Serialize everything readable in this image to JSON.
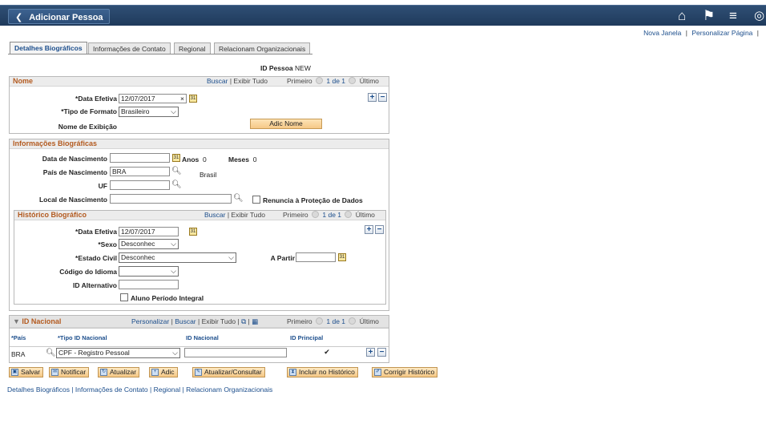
{
  "header": {
    "back_label": "Adicionar Pessoa",
    "icons": [
      "home-icon",
      "flag-icon",
      "menu-icon",
      "navbar-icon"
    ]
  },
  "top_links": {
    "new_window": "Nova Janela",
    "personalize": "Personalizar Página",
    "sep": "|"
  },
  "tabs": [
    {
      "label": "Detalhes Biográficos",
      "active": true
    },
    {
      "label": "Informações de Contato",
      "active": false
    },
    {
      "label": "Regional",
      "active": false
    },
    {
      "label": "Relacionam Organizacionais",
      "active": false
    }
  ],
  "person": {
    "id_label": "ID Pessoa",
    "id_value": "NEW"
  },
  "nome": {
    "title": "Nome",
    "find": "Buscar",
    "view_all": "Exibir Tudo",
    "first": "Primeiro",
    "page": "1 de 1",
    "last": "Último",
    "eff_date_label": "*Data Efetiva",
    "eff_date": "12/07/2017",
    "clear": "×",
    "format_label": "*Tipo de Formato",
    "format_value": "Brasileiro",
    "display_label": "Nome de Exibição",
    "add_name": "Adic Nome"
  },
  "bio": {
    "title": "Informações Biográficas",
    "birth_date_label": "Data de Nascimento",
    "birth_date": "",
    "years_label": "Anos",
    "years": "0",
    "months_label": "Meses",
    "months": "0",
    "country_label": "País de Nascimento",
    "country": "BRA",
    "country_desc": "Brasil",
    "state_label": "UF",
    "state": "",
    "place_label": "Local de Nascimento",
    "place": "",
    "waive_label": "Renuncia à Proteção de Dados"
  },
  "bio_history": {
    "title": "Histórico Biográfico",
    "find": "Buscar",
    "view_all": "Exibir Tudo",
    "first": "Primeiro",
    "page": "1 de 1",
    "last": "Último",
    "eff_date_label": "*Data Efetiva",
    "eff_date": "12/07/2017",
    "sex_label": "*Sexo",
    "sex": "Desconhec",
    "marital_label": "*Estado Civil",
    "marital": "Desconhec",
    "as_of_label": "A Partir",
    "as_of": "",
    "lang_label": "Código do Idioma",
    "lang": "",
    "alt_id_label": "ID Alternativo",
    "alt_id": "",
    "fulltime_label": "Aluno Período Integral"
  },
  "national_id": {
    "title": "ID Nacional",
    "personalize": "Personalizar",
    "find": "Buscar",
    "view_all": "Exibir Tudo",
    "first": "Primeiro",
    "page": "1 de 1",
    "last": "Último",
    "columns": [
      "*País",
      "*Tipo ID Nacional",
      "ID Nacional",
      "ID Principal"
    ],
    "rows": [
      {
        "country": "BRA",
        "type": "CPF - Registro Pessoal",
        "id": "",
        "primary": true
      }
    ]
  },
  "toolbar": {
    "save": "Salvar",
    "notify": "Notificar",
    "refresh": "Atualizar",
    "add": "Adic",
    "update": "Atualizar/Consultar",
    "include": "Incluir no Histórico",
    "correct": "Corrigir Histórico"
  },
  "footer_links": [
    "Detalhes Biográficos",
    "Informações de Contato",
    "Regional",
    "Relacionam Organizacionais"
  ]
}
